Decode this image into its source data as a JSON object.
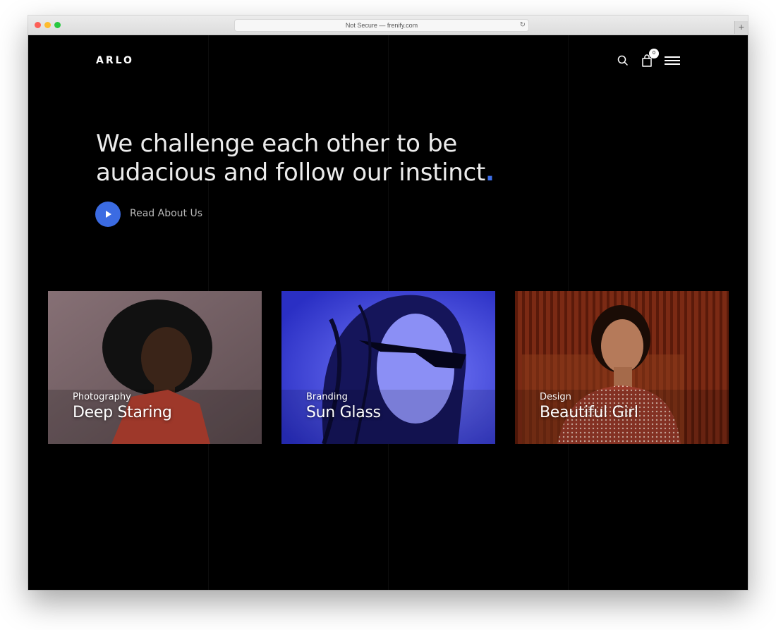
{
  "browser": {
    "url_text": "Not Secure — frenify.com",
    "reload_glyph": "↻",
    "new_tab_glyph": "+"
  },
  "header": {
    "logo": "ARLO",
    "cart_count": "0",
    "icons": [
      "search-icon",
      "cart-icon",
      "menu-icon"
    ]
  },
  "hero": {
    "headline_line1": "We challenge each other to be",
    "headline_line2": "audacious and follow our instinct",
    "headline_dot": ".",
    "cta_label": "Read About Us",
    "accent_color": "#3b6be2"
  },
  "portfolio": [
    {
      "category": "Photography",
      "title": "Deep Staring",
      "tone": "#7a6468"
    },
    {
      "category": "Branding",
      "title": "Sun Glass",
      "tone": "#3a3fd8"
    },
    {
      "category": "Design",
      "title": "Beautiful Girl",
      "tone": "#7b2a14"
    }
  ]
}
